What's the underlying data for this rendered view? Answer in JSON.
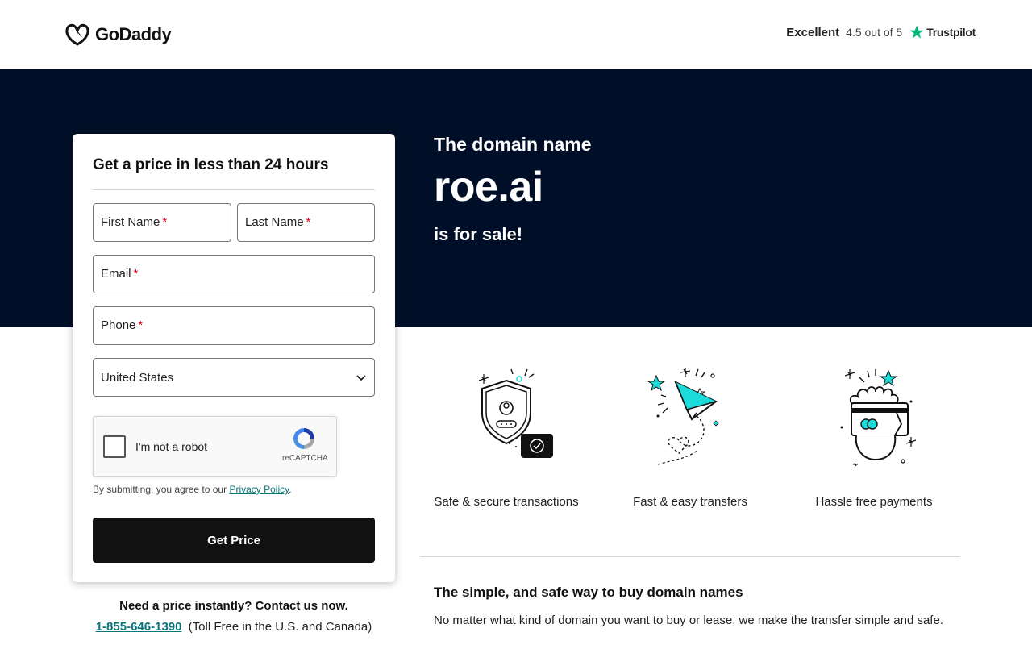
{
  "header": {
    "brand": "GoDaddy",
    "trust_rating": "Excellent",
    "trust_score": "4.5 out of 5",
    "trust_brand": "Trustpilot"
  },
  "hero": {
    "pre": "The domain name",
    "domain": "roe.ai",
    "post": "is for sale!"
  },
  "form": {
    "title": "Get a price in less than 24 hours",
    "first_name_label": "First Name",
    "last_name_label": "Last Name",
    "email_label": "Email",
    "phone_label": "Phone",
    "required_mark": "*",
    "country_value": "United States",
    "captcha_text": "I'm not a robot",
    "captcha_brand": "reCAPTCHA",
    "terms_prefix": "By submitting, you agree to our",
    "terms_link": "Privacy Policy",
    "terms_suffix": ".",
    "submit_label": "Get Price"
  },
  "contact": {
    "title": "Need a price instantly? Contact us now.",
    "phone": "1-855-646-1390",
    "phone_note": "(Toll Free in the U.S. and Canada)"
  },
  "features": [
    {
      "label": "Safe & secure transactions",
      "icon": "shield-icon"
    },
    {
      "label": "Fast & easy transfers",
      "icon": "paper-plane-icon"
    },
    {
      "label": "Hassle free payments",
      "icon": "payment-card-icon"
    }
  ],
  "info": {
    "title": "The simple, and safe way to buy domain names",
    "text": "No matter what kind of domain you want to buy or lease, we make the transfer simple and safe."
  },
  "colors": {
    "hero_bg": "#000f27",
    "accent_teal": "#09757a",
    "illustration_teal": "#1bdbdb",
    "trustpilot_green": "#00b67a",
    "button_bg": "#111111"
  }
}
